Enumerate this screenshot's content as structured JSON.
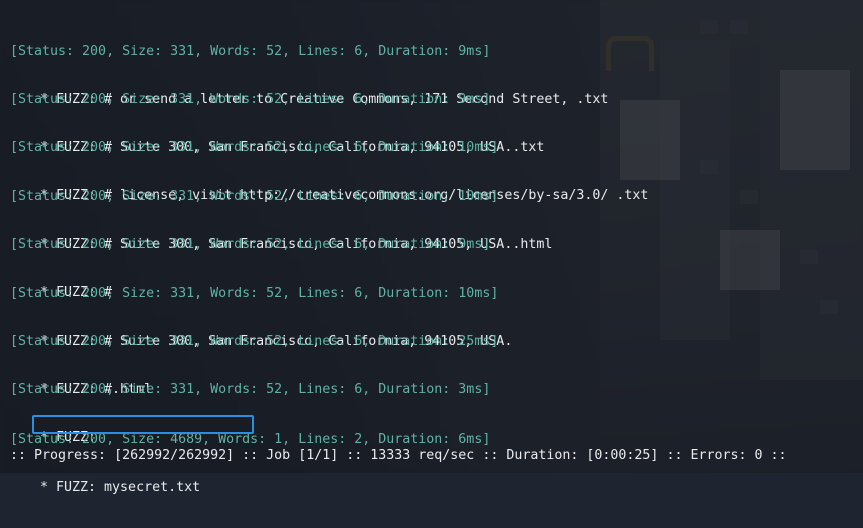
{
  "window": {
    "background": "#161a22",
    "status_color": "#5fb3a6",
    "text_color": "#e8eaee",
    "highlight_color": "#2a8fe0"
  },
  "results": [
    {
      "status": "[Status: 200, Size: 331, Words: 52, Lines: 6, Duration: 9ms]",
      "fuzz": "* FUZZ: # or send a letter to Creative Commons, 171 Second Street, .txt"
    },
    {
      "status": "[Status: 200, Size: 331, Words: 52, Lines: 6, Duration: 9ms]",
      "fuzz": "* FUZZ: # Suite 300, San Francisco, California, 94105, USA..txt"
    },
    {
      "status": "[Status: 200, Size: 331, Words: 52, Lines: 6, Duration: 10ms]",
      "fuzz": "* FUZZ: # license, visit http://creativecommons.org/licenses/by-sa/3.0/ .txt"
    },
    {
      "status": "[Status: 200, Size: 331, Words: 52, Lines: 6, Duration: 10ms]",
      "fuzz": "* FUZZ: # Suite 300, San Francisco, California, 94105, USA..html"
    },
    {
      "status": "[Status: 200, Size: 331, Words: 52, Lines: 6, Duration: 9ms]",
      "fuzz": "* FUZZ: #"
    },
    {
      "status": "[Status: 200, Size: 331, Words: 52, Lines: 6, Duration: 10ms]",
      "fuzz": "* FUZZ: # Suite 300, San Francisco, California, 94105, USA."
    },
    {
      "status": "[Status: 200, Size: 331, Words: 52, Lines: 6, Duration: 25ms]",
      "fuzz": "* FUZZ: #.html"
    },
    {
      "status": "[Status: 200, Size: 331, Words: 52, Lines: 6, Duration: 3ms]",
      "fuzz": "* FUZZ:"
    },
    {
      "status": "[Status: 200, Size: 4689, Words: 1, Lines: 2, Duration: 6ms]",
      "fuzz": "* FUZZ: mysecret.txt"
    }
  ],
  "progress_line": ":: Progress: [262992/262992] :: Job [1/1] :: 13333 req/sec :: Duration: [0:00:25] :: Errors: 0 ::"
}
